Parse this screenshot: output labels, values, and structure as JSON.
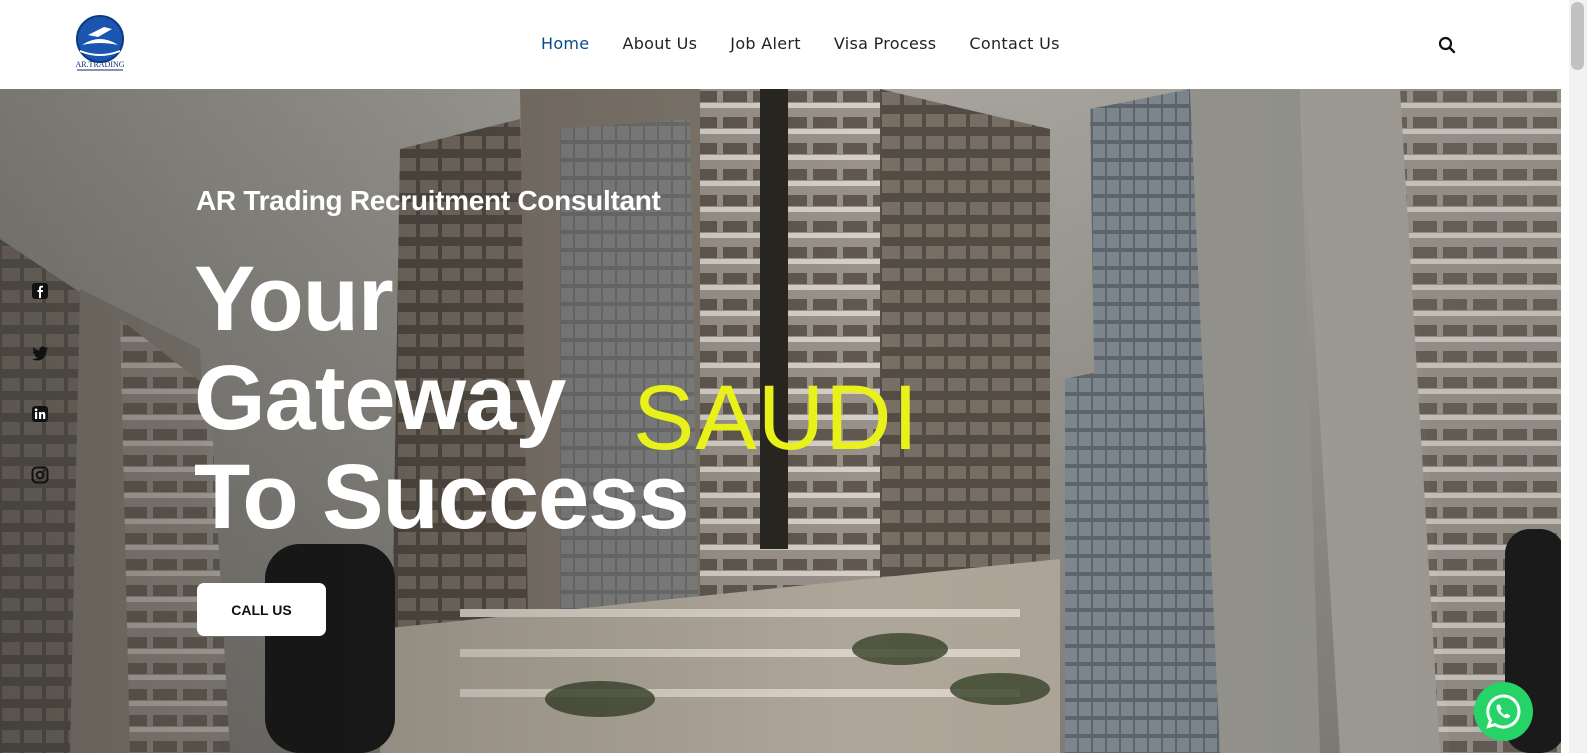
{
  "header": {
    "logo_text": "AR.TRADING",
    "nav": [
      {
        "label": "Home",
        "active": true
      },
      {
        "label": "About Us",
        "active": false
      },
      {
        "label": "Job Alert",
        "active": false
      },
      {
        "label": "Visa Process",
        "active": false
      },
      {
        "label": "Contact Us",
        "active": false
      }
    ],
    "search_icon": "search-icon"
  },
  "hero": {
    "eyebrow": "AR Trading Recruitment Consultant",
    "headline": [
      "Your",
      "Gateway",
      "To Success"
    ],
    "rotating_word": "SAUDI",
    "cta_label": "CALL US"
  },
  "social": [
    "facebook-icon",
    "twitter-icon",
    "linkedin-icon",
    "instagram-icon"
  ],
  "whatsapp": "whatsapp-icon",
  "colors": {
    "nav_active": "#0a4a8a",
    "nav_text": "#222222",
    "highlight": "#e8f21a",
    "whatsapp": "#25d366"
  }
}
